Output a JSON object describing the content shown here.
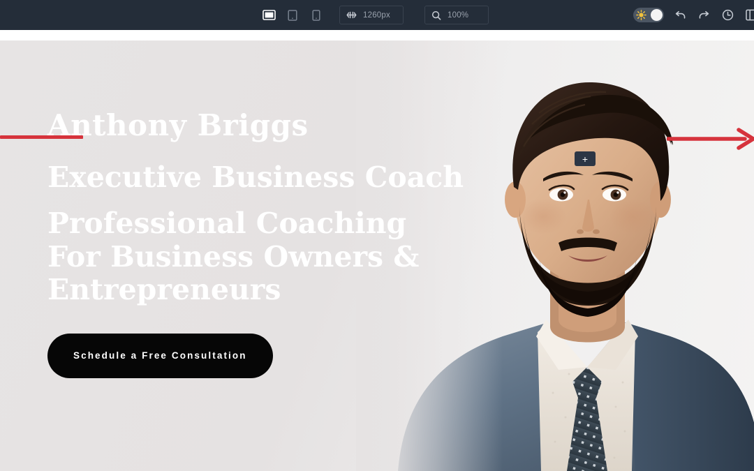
{
  "toolbar": {
    "devices": [
      {
        "name": "desktop",
        "icon": "desktop-icon",
        "active": true
      },
      {
        "name": "tablet",
        "icon": "tablet-icon",
        "active": false
      },
      {
        "name": "mobile",
        "icon": "mobile-icon",
        "active": false
      }
    ],
    "width_field": {
      "icon": "responsive-width-icon",
      "value": "1260px"
    },
    "zoom_field": {
      "icon": "magnifier-icon",
      "value": "100%"
    },
    "theme_toggle": {
      "icon": "sun-icon",
      "state": "light"
    },
    "undo": {
      "icon": "undo-icon",
      "label": "Undo"
    },
    "redo": {
      "icon": "redo-icon",
      "label": "Redo"
    },
    "history": {
      "icon": "clock-history-icon",
      "label": "History"
    },
    "edge": {
      "icon": "panel-icon",
      "label": "Panel"
    },
    "bg_color": "#242d39",
    "accent_color": "#f2c23c"
  },
  "annotations": {
    "red_color": "#d6333c",
    "left_line": "red-underline-marker",
    "right_arrow": "red-arrow-marker"
  },
  "canvas": {
    "add_badge": {
      "label": "+",
      "icon": "plus-icon"
    },
    "hero": {
      "name": "Anthony Briggs",
      "role": "Executive Business Coach",
      "headline": "Professional Coaching For Business Owners & Entrepreneurs",
      "cta_label": "Schedule a Free Consultation",
      "background_color": "#e6e3e3",
      "text_color": "#ffffff",
      "cta_bg_color": "#060606",
      "portrait_alt": "portrait-businessman-suit"
    }
  }
}
